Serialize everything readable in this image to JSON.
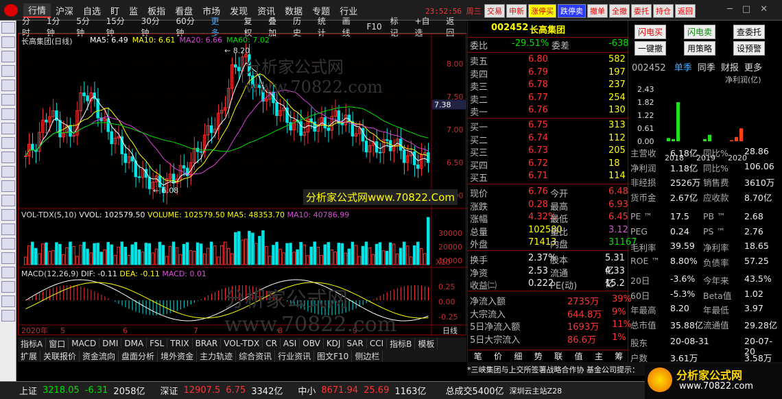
{
  "menu": [
    "行情",
    "沪深",
    "自选",
    "盯",
    "监",
    "板指",
    "看盘",
    "市场",
    "发现",
    "资讯",
    "数据",
    "专题",
    "行业"
  ],
  "clock": "23:52:56",
  "weekday": "周三",
  "trade_buttons": [
    "交易",
    "申新",
    "涨停买",
    "跌停卖",
    "撤单",
    "全撤",
    "委托",
    "持仓",
    "返回"
  ],
  "period_tabs": [
    "分时",
    "1分钟",
    "5分钟",
    "15分钟",
    "30分钟",
    "60分钟",
    "更多"
  ],
  "toolbar": [
    "复权",
    "叠加",
    "历史",
    "统计",
    "画线",
    "F10",
    "标记",
    "+自选",
    "返回"
  ],
  "kline": {
    "title": "长高集团(日线)",
    "ma": [
      {
        "name": "MA5: 6.49",
        "color": "#ffffff"
      },
      {
        "name": "MA10: 6.61",
        "color": "#ffff00"
      },
      {
        "name": "MA20: 6.66",
        "color": "#e040e0"
      },
      {
        "name": "MA60: 7.02",
        "color": "#00e000"
      }
    ],
    "price_axis": [
      "8.00",
      "7.50",
      "7.00",
      "6.50",
      "6.00"
    ],
    "cursor_price": "7.38",
    "high_label": "8.20",
    "low_label": "6.08",
    "watermark": "分析家公式网www.70822.com",
    "watermark2": "分析家公式网www.70822.Com"
  },
  "vol": {
    "title": "VOL-TDX(5,10)",
    "vvol": "VVOL: 102579.50",
    "volume": "VOLUME: 102579.50",
    "ma5": "MA5: 48353.70",
    "ma10": "MA10: 40786.99",
    "axis": [
      "30000",
      "20000",
      "10000"
    ],
    "unit": "X10"
  },
  "macd": {
    "title": "MACD(12,26,9)",
    "dif": "DIF: -0.11",
    "dea": "DEA: -0.11",
    "macd": "MACD: 0.01",
    "axis": [
      "0.25",
      "0.00",
      "-0.25"
    ]
  },
  "date_axis": [
    "2020年",
    "5",
    "6",
    "7",
    "8",
    "9"
  ],
  "date_right": "日线",
  "indicator_tabs": [
    "指标A",
    "窗口",
    "MACD",
    "DMI",
    "DMA",
    "FSL",
    "TRIX",
    "BRAR",
    "VOL-TDX",
    "CR",
    "ASI",
    "OBV",
    "KDJ",
    "SAR",
    "CCI",
    "指标B",
    "模板"
  ],
  "ext_tabs": [
    "扩展",
    "关联报价",
    "资金流向",
    "盘面分析",
    "境外资金",
    "主力轨迹",
    "综合资讯",
    "行业资讯",
    "图文F10",
    "侧边栏"
  ],
  "quote": {
    "code": "002452",
    "name": "长高集团",
    "weibi_label": "委比",
    "weibi": "-29.51%",
    "weicha_label": "委差",
    "weicha": "-638",
    "asks": [
      [
        "卖五",
        "6.80",
        "582"
      ],
      [
        "卖四",
        "6.79",
        "197"
      ],
      [
        "卖三",
        "6.78",
        "237"
      ],
      [
        "卖二",
        "6.77",
        "254"
      ],
      [
        "卖一",
        "6.76",
        "130"
      ]
    ],
    "bids": [
      [
        "买一",
        "6.75",
        "313"
      ],
      [
        "买二",
        "6.74",
        "112"
      ],
      [
        "买三",
        "6.73",
        "205"
      ],
      [
        "买四",
        "6.72",
        "18"
      ],
      [
        "买五",
        "6.71",
        "114"
      ]
    ],
    "stats": [
      [
        "现价",
        "6.76",
        "今开",
        "6.48"
      ],
      [
        "涨跌",
        "0.28",
        "最高",
        "6.93"
      ],
      [
        "涨幅",
        "4.32%",
        "最低",
        "6.45"
      ],
      [
        "总量",
        "102580",
        "量比",
        "3.12"
      ],
      [
        "外盘",
        "71413",
        "内盘",
        "31167"
      ]
    ],
    "stats2": [
      [
        "换手",
        "2.37%",
        "股本",
        "5.31亿"
      ],
      [
        "净资",
        "2.53",
        "流通",
        "4.33亿"
      ],
      [
        "收益㈡",
        "0.222",
        "PE(动)",
        "15.2"
      ]
    ],
    "flows": [
      [
        "净流入额",
        "2735万",
        "39%"
      ],
      [
        "大宗流入",
        "644.8万",
        "9%"
      ],
      [
        "5日净流入额",
        "1693万",
        "11%"
      ],
      [
        "5日大宗流入",
        "86.6万",
        "1%"
      ]
    ],
    "bottom_tabs": [
      "笔",
      "价",
      "细",
      "势",
      "联",
      "值",
      "主",
      "筹"
    ]
  },
  "fin": {
    "buttons": [
      "闪电买",
      "闪电卖",
      "查委托",
      "一键撤",
      "用策略",
      "设预警"
    ],
    "code": "002452",
    "tabs": [
      "单季",
      "同季",
      "财报",
      "更多"
    ],
    "chart_title": "净利润(亿)",
    "chart_axis": [
      "2.43",
      "1.82",
      "1.22",
      "0.61",
      "0.00"
    ],
    "rows1": [
      [
        "主营收",
        "6.18亿",
        "同比%",
        "28.86"
      ],
      [
        "净利润",
        "1.18亿",
        "同比%",
        "106.06"
      ],
      [
        "非经损",
        "2526万",
        "销售费",
        "3610万"
      ],
      [
        "货币金",
        "2.67亿",
        "应收款",
        "8.70亿"
      ]
    ],
    "rows2": [
      [
        "PE ™",
        "17.5",
        "PB ™",
        "2.68"
      ],
      [
        "PEG",
        "0.24",
        "PS ™",
        "2.76"
      ],
      [
        "毛利率",
        "39.59",
        "净利率",
        "18.65"
      ],
      [
        "ROE ™",
        "8.80%",
        "负债率",
        "57.25"
      ]
    ],
    "rows3": [
      [
        "20日",
        "-3.6%",
        "今年来",
        "43.5%"
      ],
      [
        "60日",
        "-5.3%",
        "Beta值",
        "1.02"
      ],
      [
        "年最高",
        "8.20",
        "年最低",
        "3.97"
      ],
      [
        "总市值",
        "35.88亿",
        "流通值",
        "29.28亿"
      ]
    ],
    "rows4": [
      [
        "股东",
        "20-08-31",
        "",
        "20-07-20"
      ],
      [
        "户数",
        "3.61万",
        "",
        "3.58万"
      ]
    ]
  },
  "fin_chart": {
    "type": "bar",
    "categories": [
      "2018",
      "2019",
      "2020"
    ],
    "values": [
      0.15,
      0.1,
      1.82,
      0.0,
      0.1,
      0.3,
      0.05,
      0.2,
      0.6
    ]
  },
  "news": "*三峡集团与上交所签署战略合作协   基金公司提示：",
  "ticker": [
    {
      "name": "上证",
      "value": "3218.05",
      "chg": "-6.31",
      "amt": "2058亿"
    },
    {
      "name": "深证",
      "value": "12907.5",
      "chg": "6.75",
      "amt": "3342亿"
    },
    {
      "name": "中小",
      "value": "8671.94",
      "chg": "25.69",
      "amt": "1163亿"
    }
  ],
  "ticker_total": "总成交5400亿",
  "ticker_site": "深圳云主站Z28",
  "brand": "分析家公式网",
  "brand_url": "www.70822.com"
}
